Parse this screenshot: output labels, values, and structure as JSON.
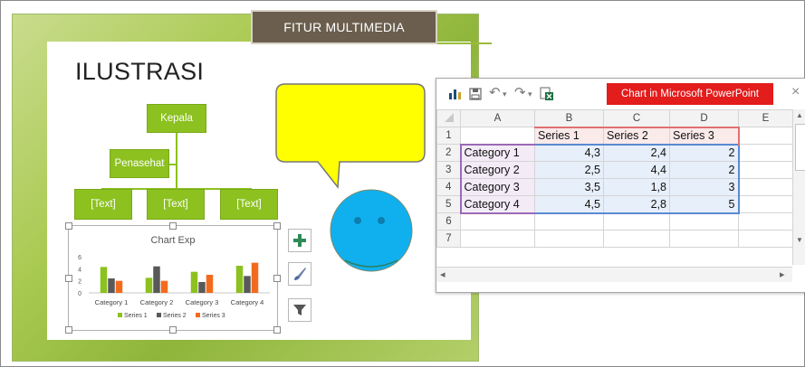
{
  "slide": {
    "banner": "FITUR MULTIMEDIA",
    "title": "ILUSTRASI",
    "org": {
      "top": "Kepala",
      "assistant": "Penasehat",
      "children": [
        "[Text]",
        "[Text]",
        "[Text]"
      ]
    },
    "colors": {
      "org_green": "#8cc11f",
      "bubble": "#ffff00",
      "smiley": "#10b0ee",
      "banner_bg": "#6b5e4e"
    }
  },
  "side_buttons": [
    {
      "icon": "plus-icon"
    },
    {
      "icon": "brush-icon"
    },
    {
      "icon": "filter-icon"
    }
  ],
  "chart_data": {
    "type": "bar",
    "title": "Chart Exp",
    "categories": [
      "Category 1",
      "Category 2",
      "Category 3",
      "Category 4"
    ],
    "series": [
      {
        "name": "Series 1",
        "values": [
          4.3,
          2.5,
          3.5,
          4.5
        ],
        "color": "#8cc11f"
      },
      {
        "name": "Series 2",
        "values": [
          2.4,
          4.4,
          1.8,
          2.8
        ],
        "color": "#595959"
      },
      {
        "name": "Series 3",
        "values": [
          2,
          2,
          3,
          5
        ],
        "color": "#f26b1d"
      }
    ],
    "yticks": [
      "6",
      "4",
      "2",
      "0"
    ],
    "ylim": [
      0,
      6
    ],
    "legend": "bottom",
    "grid": false
  },
  "sheet": {
    "window_title": "Chart in Microsoft PowerPoint",
    "close_symbol": "×",
    "undo_symbol": "↶",
    "redo_symbol": "↷",
    "dropdown_symbol": "▾",
    "col_headers": [
      "A",
      "B",
      "C",
      "D",
      "E"
    ],
    "rows": [
      {
        "n": "1",
        "cells": [
          "",
          "Series 1",
          "Series 2",
          "Series 3",
          ""
        ]
      },
      {
        "n": "2",
        "cells": [
          "Category 1",
          "4,3",
          "2,4",
          "2",
          ""
        ]
      },
      {
        "n": "3",
        "cells": [
          "Category 2",
          "2,5",
          "4,4",
          "2",
          ""
        ]
      },
      {
        "n": "4",
        "cells": [
          "Category 3",
          "3,5",
          "1,8",
          "3",
          ""
        ]
      },
      {
        "n": "5",
        "cells": [
          "Category 4",
          "4,5",
          "2,8",
          "5",
          ""
        ]
      },
      {
        "n": "6",
        "cells": [
          "",
          "",
          "",
          "",
          ""
        ]
      },
      {
        "n": "7",
        "cells": [
          "",
          "",
          "",
          "",
          ""
        ]
      }
    ],
    "scroll_up": "▲",
    "scroll_down": "▼",
    "scroll_left": "◂",
    "scroll_right": "▸"
  }
}
